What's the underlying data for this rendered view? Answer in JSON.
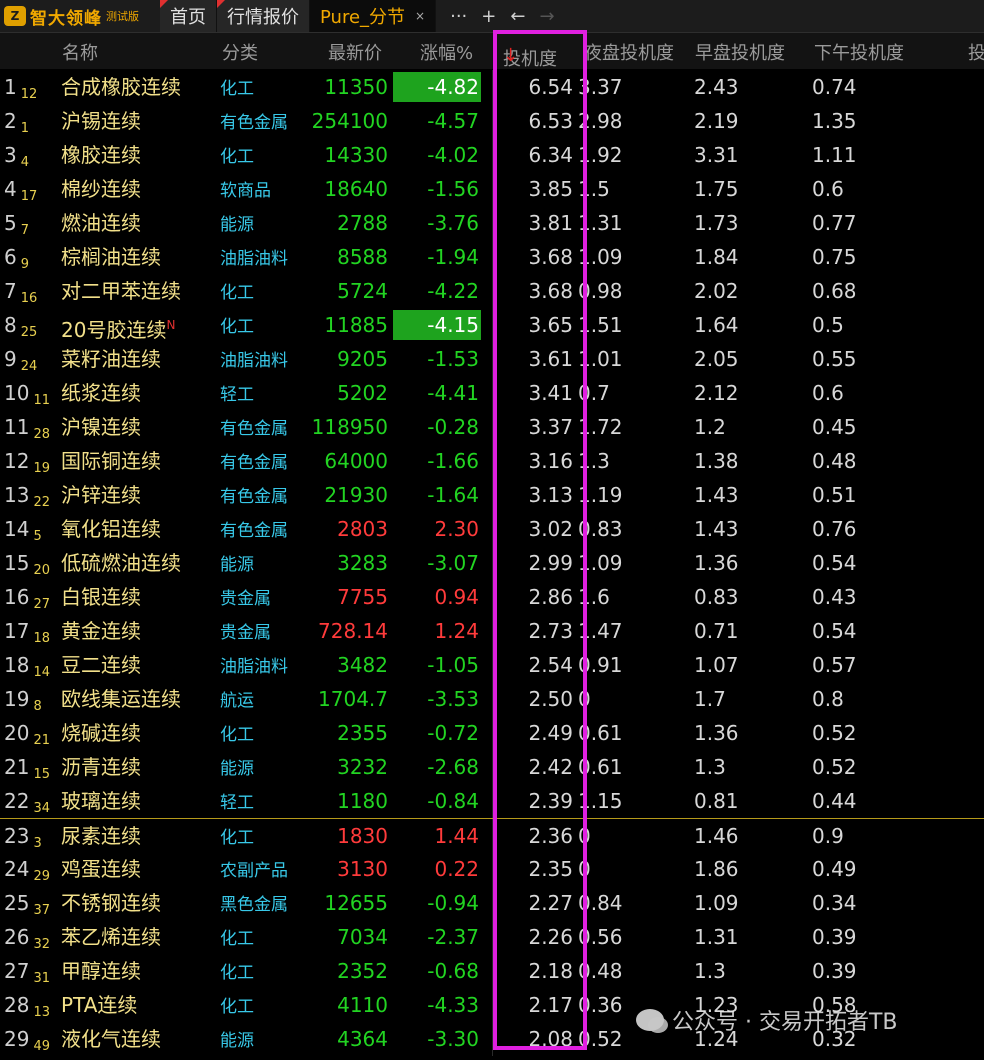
{
  "app": {
    "logo_badge": "Z",
    "name": "智大领峰",
    "edition": "测试版"
  },
  "tabs": [
    {
      "label": "首页"
    },
    {
      "label": "行情报价"
    },
    {
      "label": "Pure_分节",
      "active": true
    }
  ],
  "tab_close": "×",
  "tools": {
    "more": "···",
    "add": "+",
    "back": "←",
    "forward": "→"
  },
  "columns": {
    "name": "名称",
    "category": "分类",
    "price": "最新价",
    "change": "涨幅%",
    "tj": "投机度",
    "sort_arrow": "↓",
    "night": "夜盘投机度",
    "morning": "早盘投机度",
    "afternoon": "下午投机度",
    "extra": "投"
  },
  "colors": {
    "up": "#ff3b3b",
    "down": "#22d422",
    "name": "#f2e08a",
    "category": "#38c8e8",
    "highlight_box": "#e020e0",
    "change_highlight": "#1ea31e"
  },
  "rows": [
    {
      "idx": "1",
      "sub": "12",
      "name": "合成橡胶连续",
      "cat": "化工",
      "price": "11350",
      "chg": "-4.82",
      "tj": "6.54",
      "ye": "3.37",
      "zao": "2.43",
      "xw": "0.74",
      "hl": true
    },
    {
      "idx": "2",
      "sub": "1",
      "name": "沪锡连续",
      "cat": "有色金属",
      "price": "254100",
      "chg": "-4.57",
      "tj": "6.53",
      "ye": "2.98",
      "zao": "2.19",
      "xw": "1.35"
    },
    {
      "idx": "3",
      "sub": "4",
      "name": "橡胶连续",
      "cat": "化工",
      "price": "14330",
      "chg": "-4.02",
      "tj": "6.34",
      "ye": "1.92",
      "zao": "3.31",
      "xw": "1.11"
    },
    {
      "idx": "4",
      "sub": "17",
      "name": "棉纱连续",
      "cat": "软商品",
      "price": "18640",
      "chg": "-1.56",
      "tj": "3.85",
      "ye": "1.5",
      "zao": "1.75",
      "xw": "0.6"
    },
    {
      "idx": "5",
      "sub": "7",
      "name": "燃油连续",
      "cat": "能源",
      "price": "2788",
      "chg": "-3.76",
      "tj": "3.81",
      "ye": "1.31",
      "zao": "1.73",
      "xw": "0.77"
    },
    {
      "idx": "6",
      "sub": "9",
      "name": "棕榈油连续",
      "cat": "油脂油料",
      "price": "8588",
      "chg": "-1.94",
      "tj": "3.68",
      "ye": "1.09",
      "zao": "1.84",
      "xw": "0.75"
    },
    {
      "idx": "7",
      "sub": "16",
      "name": "对二甲苯连续",
      "cat": "化工",
      "price": "5724",
      "chg": "-4.22",
      "tj": "3.68",
      "ye": "0.98",
      "zao": "2.02",
      "xw": "0.68"
    },
    {
      "idx": "8",
      "sub": "25",
      "name": "20号胶连续",
      "sup": "N",
      "cat": "化工",
      "price": "11885",
      "chg": "-4.15",
      "tj": "3.65",
      "ye": "1.51",
      "zao": "1.64",
      "xw": "0.5",
      "hl": true
    },
    {
      "idx": "9",
      "sub": "24",
      "name": "菜籽油连续",
      "cat": "油脂油料",
      "price": "9205",
      "chg": "-1.53",
      "tj": "3.61",
      "ye": "1.01",
      "zao": "2.05",
      "xw": "0.55"
    },
    {
      "idx": "10",
      "sub": "11",
      "name": "纸浆连续",
      "cat": "轻工",
      "price": "5202",
      "chg": "-4.41",
      "tj": "3.41",
      "ye": "0.7",
      "zao": "2.12",
      "xw": "0.6"
    },
    {
      "idx": "11",
      "sub": "28",
      "name": "沪镍连续",
      "cat": "有色金属",
      "price": "118950",
      "chg": "-0.28",
      "tj": "3.37",
      "ye": "1.72",
      "zao": "1.2",
      "xw": "0.45"
    },
    {
      "idx": "12",
      "sub": "19",
      "name": "国际铜连续",
      "cat": "有色金属",
      "price": "64000",
      "chg": "-1.66",
      "tj": "3.16",
      "ye": "1.3",
      "zao": "1.38",
      "xw": "0.48"
    },
    {
      "idx": "13",
      "sub": "22",
      "name": "沪锌连续",
      "cat": "有色金属",
      "price": "21930",
      "chg": "-1.64",
      "tj": "3.13",
      "ye": "1.19",
      "zao": "1.43",
      "xw": "0.51"
    },
    {
      "idx": "14",
      "sub": "5",
      "name": "氧化铝连续",
      "cat": "有色金属",
      "price": "2803",
      "chg": "2.30",
      "tj": "3.02",
      "ye": "0.83",
      "zao": "1.43",
      "xw": "0.76",
      "up": true
    },
    {
      "idx": "15",
      "sub": "20",
      "name": "低硫燃油连续",
      "cat": "能源",
      "price": "3283",
      "chg": "-3.07",
      "tj": "2.99",
      "ye": "1.09",
      "zao": "1.36",
      "xw": "0.54"
    },
    {
      "idx": "16",
      "sub": "27",
      "name": "白银连续",
      "cat": "贵金属",
      "price": "7755",
      "chg": "0.94",
      "tj": "2.86",
      "ye": "1.6",
      "zao": "0.83",
      "xw": "0.43",
      "up": true
    },
    {
      "idx": "17",
      "sub": "18",
      "name": "黄金连续",
      "cat": "贵金属",
      "price": "728.14",
      "chg": "1.24",
      "tj": "2.73",
      "ye": "1.47",
      "zao": "0.71",
      "xw": "0.54",
      "up": true
    },
    {
      "idx": "18",
      "sub": "14",
      "name": "豆二连续",
      "cat": "油脂油料",
      "price": "3482",
      "chg": "-1.05",
      "tj": "2.54",
      "ye": "0.91",
      "zao": "1.07",
      "xw": "0.57"
    },
    {
      "idx": "19",
      "sub": "8",
      "name": "欧线集运连续",
      "cat": "航运",
      "price": "1704.7",
      "chg": "-3.53",
      "tj": "2.50",
      "ye": "0",
      "zao": "1.7",
      "xw": "0.8"
    },
    {
      "idx": "20",
      "sub": "21",
      "name": "烧碱连续",
      "cat": "化工",
      "price": "2355",
      "chg": "-0.72",
      "tj": "2.49",
      "ye": "0.61",
      "zao": "1.36",
      "xw": "0.52"
    },
    {
      "idx": "21",
      "sub": "15",
      "name": "沥青连续",
      "cat": "能源",
      "price": "3232",
      "chg": "-2.68",
      "tj": "2.42",
      "ye": "0.61",
      "zao": "1.3",
      "xw": "0.52"
    },
    {
      "idx": "22",
      "sub": "34",
      "name": "玻璃连续",
      "cat": "轻工",
      "price": "1180",
      "chg": "-0.84",
      "tj": "2.39",
      "ye": "1.15",
      "zao": "0.81",
      "xw": "0.44"
    },
    {
      "idx": "23",
      "sub": "3",
      "name": "尿素连续",
      "cat": "化工",
      "price": "1830",
      "chg": "1.44",
      "tj": "2.36",
      "ye": "0",
      "zao": "1.46",
      "xw": "0.9",
      "up": true,
      "sep": true
    },
    {
      "idx": "24",
      "sub": "29",
      "name": "鸡蛋连续",
      "cat": "农副产品",
      "price": "3130",
      "chg": "0.22",
      "tj": "2.35",
      "ye": "0",
      "zao": "1.86",
      "xw": "0.49",
      "up": true
    },
    {
      "idx": "25",
      "sub": "37",
      "name": "不锈钢连续",
      "cat": "黑色金属",
      "price": "12655",
      "chg": "-0.94",
      "tj": "2.27",
      "ye": "0.84",
      "zao": "1.09",
      "xw": "0.34"
    },
    {
      "idx": "26",
      "sub": "32",
      "name": "苯乙烯连续",
      "cat": "化工",
      "price": "7034",
      "chg": "-2.37",
      "tj": "2.26",
      "ye": "0.56",
      "zao": "1.31",
      "xw": "0.39"
    },
    {
      "idx": "27",
      "sub": "31",
      "name": "甲醇连续",
      "cat": "化工",
      "price": "2352",
      "chg": "-0.68",
      "tj": "2.18",
      "ye": "0.48",
      "zao": "1.3",
      "xw": "0.39"
    },
    {
      "idx": "28",
      "sub": "13",
      "name": "PTA连续",
      "cat": "化工",
      "price": "4110",
      "chg": "-4.33",
      "tj": "2.17",
      "ye": "0.36",
      "zao": "1.23",
      "xw": "0.58"
    },
    {
      "idx": "29",
      "sub": "49",
      "name": "液化气连续",
      "cat": "能源",
      "price": "4364",
      "chg": "-3.30",
      "tj": "2.08",
      "ye": "0.52",
      "zao": "1.24",
      "xw": "0.32"
    }
  ],
  "watermark": {
    "text": "公众号 · 交易开拓者TB"
  }
}
